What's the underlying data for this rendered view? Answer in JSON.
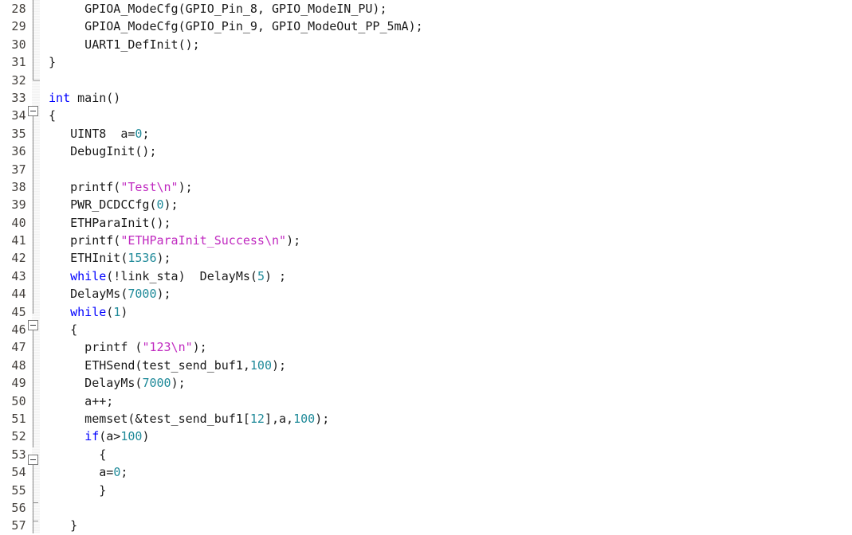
{
  "editor": {
    "name": "source-code-editor",
    "language": "c",
    "first_line_number": 28,
    "line_height_px": 22.4,
    "colors": {
      "background": "#ffffff",
      "text": "#1a1a1a",
      "keyword": "#0000ff",
      "number": "#1f8a99",
      "string": "#c02ac0",
      "line_number": "#44403c",
      "fold_line": "#8c8c8c",
      "gutter_stripe": "#f2f2f2"
    },
    "line_numbers": [
      "28",
      "29",
      "30",
      "31",
      "32",
      "33",
      "34",
      "35",
      "36",
      "37",
      "38",
      "39",
      "40",
      "41",
      "42",
      "43",
      "44",
      "45",
      "46",
      "47",
      "48",
      "49",
      "50",
      "51",
      "52",
      "53",
      "54",
      "55",
      "56",
      "57"
    ],
    "fold_markers": [
      {
        "line": 34,
        "type": "minus-box"
      },
      {
        "line": 46,
        "type": "minus-box"
      },
      {
        "line": 53,
        "type": "minus-box"
      },
      {
        "line": 56,
        "type": "tick"
      },
      {
        "line": 57,
        "type": "tick"
      },
      {
        "line": 32,
        "type": "corner-end"
      }
    ],
    "lines": [
      {
        "number": "28",
        "tokens": [
          {
            "t": "      GPIOA_ModeCfg(GPIO_Pin_8, GPIO_ModeIN_PU);",
            "c": "plain"
          }
        ]
      },
      {
        "number": "29",
        "tokens": [
          {
            "t": "      GPIOA_ModeCfg(GPIO_Pin_9, GPIO_ModeOut_PP_5mA);",
            "c": "plain"
          }
        ]
      },
      {
        "number": "30",
        "tokens": [
          {
            "t": "      UART1_DefInit();",
            "c": "plain"
          }
        ]
      },
      {
        "number": "31",
        "tokens": [
          {
            "t": " }",
            "c": "plain"
          }
        ]
      },
      {
        "number": "32",
        "tokens": [
          {
            "t": "",
            "c": "plain"
          }
        ]
      },
      {
        "number": "33",
        "tokens": [
          {
            "t": " ",
            "c": "plain"
          },
          {
            "t": "int",
            "c": "kw"
          },
          {
            "t": " main()",
            "c": "plain"
          }
        ]
      },
      {
        "number": "34",
        "tokens": [
          {
            "t": " {",
            "c": "plain"
          }
        ]
      },
      {
        "number": "35",
        "tokens": [
          {
            "t": "    UINT8  a=",
            "c": "plain"
          },
          {
            "t": "0",
            "c": "num"
          },
          {
            "t": ";",
            "c": "plain"
          }
        ]
      },
      {
        "number": "36",
        "tokens": [
          {
            "t": "    DebugInit();",
            "c": "plain"
          }
        ]
      },
      {
        "number": "37",
        "tokens": [
          {
            "t": "",
            "c": "plain"
          }
        ]
      },
      {
        "number": "38",
        "tokens": [
          {
            "t": "    printf(",
            "c": "plain"
          },
          {
            "t": "\"Test\\n\"",
            "c": "str"
          },
          {
            "t": ");",
            "c": "plain"
          }
        ]
      },
      {
        "number": "39",
        "tokens": [
          {
            "t": "    PWR_DCDCCfg(",
            "c": "plain"
          },
          {
            "t": "0",
            "c": "num"
          },
          {
            "t": ");",
            "c": "plain"
          }
        ]
      },
      {
        "number": "40",
        "tokens": [
          {
            "t": "    ETHParaInit();",
            "c": "plain"
          }
        ]
      },
      {
        "number": "41",
        "tokens": [
          {
            "t": "    printf(",
            "c": "plain"
          },
          {
            "t": "\"ETHParaInit_Success\\n\"",
            "c": "str"
          },
          {
            "t": ");",
            "c": "plain"
          }
        ]
      },
      {
        "number": "42",
        "tokens": [
          {
            "t": "    ETHInit(",
            "c": "plain"
          },
          {
            "t": "1536",
            "c": "num"
          },
          {
            "t": ");",
            "c": "plain"
          }
        ]
      },
      {
        "number": "43",
        "tokens": [
          {
            "t": "    ",
            "c": "plain"
          },
          {
            "t": "while",
            "c": "kw"
          },
          {
            "t": "(!link_sta)  DelayMs(",
            "c": "plain"
          },
          {
            "t": "5",
            "c": "num"
          },
          {
            "t": ") ;",
            "c": "plain"
          }
        ]
      },
      {
        "number": "44",
        "tokens": [
          {
            "t": "    DelayMs(",
            "c": "plain"
          },
          {
            "t": "7000",
            "c": "num"
          },
          {
            "t": ");",
            "c": "plain"
          }
        ]
      },
      {
        "number": "45",
        "tokens": [
          {
            "t": "    ",
            "c": "plain"
          },
          {
            "t": "while",
            "c": "kw"
          },
          {
            "t": "(",
            "c": "plain"
          },
          {
            "t": "1",
            "c": "num"
          },
          {
            "t": ")",
            "c": "plain"
          }
        ]
      },
      {
        "number": "46",
        "tokens": [
          {
            "t": "    {",
            "c": "plain"
          }
        ]
      },
      {
        "number": "47",
        "tokens": [
          {
            "t": "      printf (",
            "c": "plain"
          },
          {
            "t": "\"123\\n\"",
            "c": "str"
          },
          {
            "t": ");",
            "c": "plain"
          }
        ]
      },
      {
        "number": "48",
        "tokens": [
          {
            "t": "      ETHSend(test_send_buf1,",
            "c": "plain"
          },
          {
            "t": "100",
            "c": "num"
          },
          {
            "t": ");",
            "c": "plain"
          }
        ]
      },
      {
        "number": "49",
        "tokens": [
          {
            "t": "      DelayMs(",
            "c": "plain"
          },
          {
            "t": "7000",
            "c": "num"
          },
          {
            "t": ");",
            "c": "plain"
          }
        ]
      },
      {
        "number": "50",
        "tokens": [
          {
            "t": "      a++;",
            "c": "plain"
          }
        ]
      },
      {
        "number": "51",
        "tokens": [
          {
            "t": "      memset(&test_send_buf1[",
            "c": "plain"
          },
          {
            "t": "12",
            "c": "num"
          },
          {
            "t": "],a,",
            "c": "plain"
          },
          {
            "t": "100",
            "c": "num"
          },
          {
            "t": ");",
            "c": "plain"
          }
        ]
      },
      {
        "number": "52",
        "tokens": [
          {
            "t": "      ",
            "c": "plain"
          },
          {
            "t": "if",
            "c": "kw"
          },
          {
            "t": "(a>",
            "c": "plain"
          },
          {
            "t": "100",
            "c": "num"
          },
          {
            "t": ")",
            "c": "plain"
          }
        ]
      },
      {
        "number": "53",
        "tokens": [
          {
            "t": "        {",
            "c": "plain"
          }
        ]
      },
      {
        "number": "54",
        "tokens": [
          {
            "t": "        a=",
            "c": "plain"
          },
          {
            "t": "0",
            "c": "num"
          },
          {
            "t": ";",
            "c": "plain"
          }
        ]
      },
      {
        "number": "55",
        "tokens": [
          {
            "t": "        }",
            "c": "plain"
          }
        ]
      },
      {
        "number": "56",
        "tokens": [
          {
            "t": "",
            "c": "plain"
          }
        ]
      },
      {
        "number": "57",
        "tokens": [
          {
            "t": "    }",
            "c": "plain"
          }
        ]
      }
    ]
  }
}
